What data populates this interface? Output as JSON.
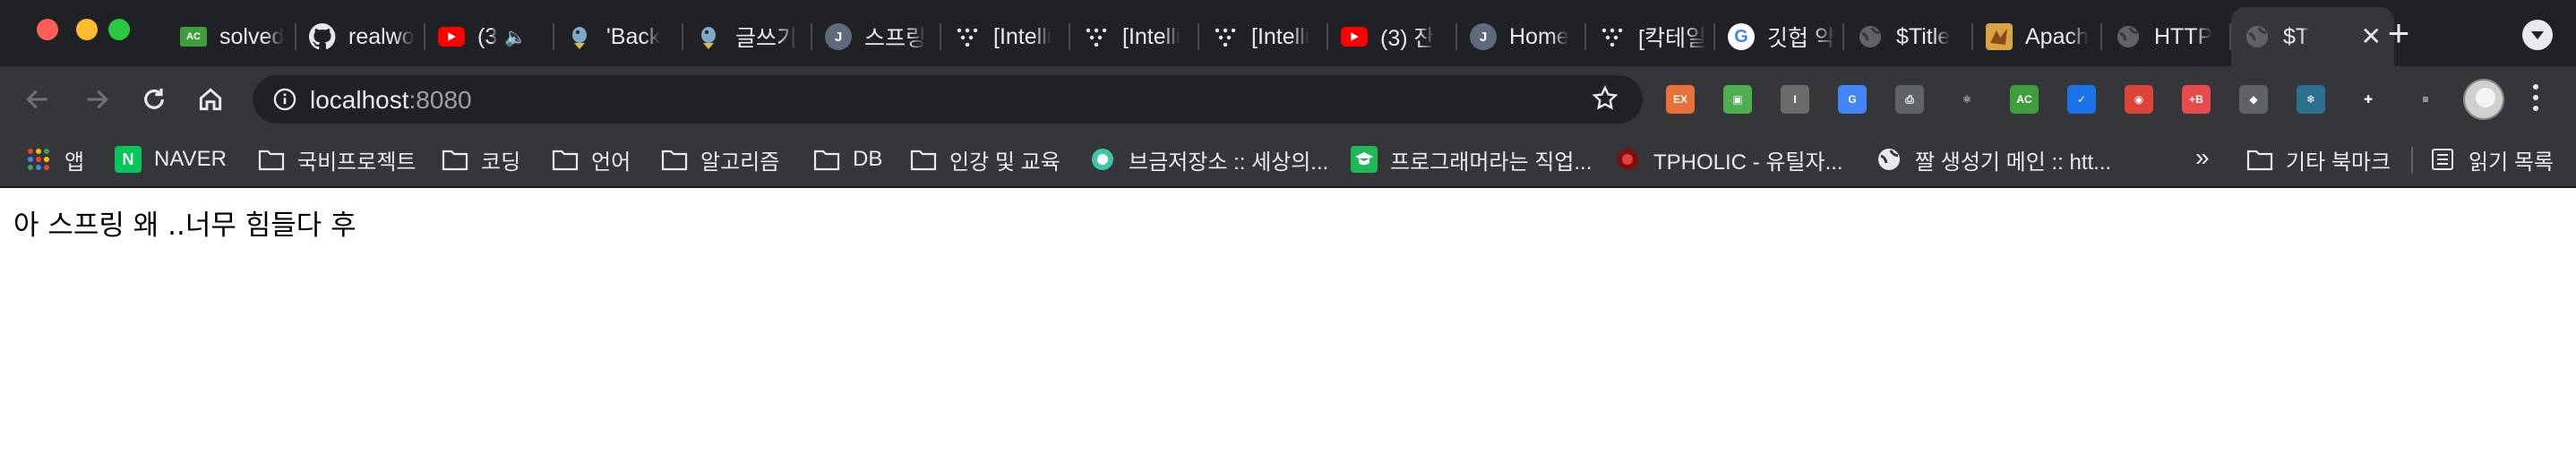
{
  "tabs": [
    {
      "title": "solved",
      "favicon": "ac-icon"
    },
    {
      "title": "realwo",
      "favicon": "github-icon"
    },
    {
      "title": "(3",
      "favicon": "youtube-icon",
      "audio": true
    },
    {
      "title": "'Back",
      "favicon": "bird-icon"
    },
    {
      "title": "글쓰기",
      "favicon": "bird-icon"
    },
    {
      "title": "스프링",
      "favicon": "j-icon"
    },
    {
      "title": "[Intelli",
      "favicon": "dots-icon"
    },
    {
      "title": "[Intelli",
      "favicon": "dots-icon"
    },
    {
      "title": "[Intelli",
      "favicon": "dots-icon"
    },
    {
      "title": "(3) 잔",
      "favicon": "youtube-icon"
    },
    {
      "title": "Home",
      "favicon": "j-icon"
    },
    {
      "title": "[칵테일",
      "favicon": "dots-icon"
    },
    {
      "title": "깃헙 약",
      "favicon": "google-icon"
    },
    {
      "title": "$Title",
      "favicon": "globe-icon"
    },
    {
      "title": "Apach",
      "favicon": "apache-icon"
    },
    {
      "title": "HTTP",
      "favicon": "globe-icon"
    },
    {
      "title": "$T",
      "favicon": "globe-icon",
      "active": true
    }
  ],
  "toolbar": {
    "url_host": "localhost",
    "url_port": ":8080"
  },
  "extensions": [
    {
      "name": "ex-extension-icon",
      "label": "EX",
      "color": "#e8703a"
    },
    {
      "name": "screen-extension-icon",
      "label": "▣",
      "color": "#4caf50"
    },
    {
      "name": "i-extension-icon",
      "label": "I",
      "color": "#6b6b6b"
    },
    {
      "name": "translate-extension-icon",
      "label": "G",
      "color": "#4285f4"
    },
    {
      "name": "print-extension-icon",
      "label": "⎙",
      "color": "#5f6368"
    },
    {
      "name": "react-extension-icon",
      "label": "⚛",
      "color": "#35363a"
    },
    {
      "name": "ac-extension-icon",
      "label": "AC",
      "color": "#3e9e3e"
    },
    {
      "name": "check-extension-icon",
      "label": "✓",
      "color": "#1a73e8"
    },
    {
      "name": "chrome-extension-icon",
      "label": "◉",
      "color": "#db4437"
    },
    {
      "name": "b-extension-icon",
      "label": "+B",
      "color": "#e84b4b"
    },
    {
      "name": "cube-extension-icon",
      "label": "◆",
      "color": "#5f6368"
    },
    {
      "name": "snow-extension-icon",
      "label": "❄",
      "color": "#2c6f8f"
    },
    {
      "name": "puzzle-icon",
      "label": "✚",
      "color": "#35363a"
    },
    {
      "name": "media-icon",
      "label": "≡",
      "color": "#35363a"
    }
  ],
  "bookmarks": [
    {
      "label": "앱",
      "icon": "apps-grid-icon"
    },
    {
      "label": "NAVER",
      "icon": "naver-icon"
    },
    {
      "label": "국비프로젝트",
      "icon": "folder-icon"
    },
    {
      "label": "코딩",
      "icon": "folder-icon"
    },
    {
      "label": "언어",
      "icon": "folder-icon"
    },
    {
      "label": "알고리즘",
      "icon": "folder-icon"
    },
    {
      "label": "DB",
      "icon": "folder-icon"
    },
    {
      "label": "인강 및 교육",
      "icon": "folder-icon"
    },
    {
      "label": "브금저장소 :: 세상의...",
      "icon": "circle-icon"
    },
    {
      "label": "프로그래머라는 직업...",
      "icon": "cap-icon"
    },
    {
      "label": "TPHOLIC - 유틸자...",
      "icon": "tpholic-icon"
    },
    {
      "label": "짤 생성기 메인 :: htt...",
      "icon": "globe-icon"
    }
  ],
  "bookmarks_overflow": "»",
  "other_bookmarks": "기타 북마크",
  "reading_list": "읽기 목록",
  "page": {
    "body_text": "아 스프링 왜 ..너무 힘들다 후"
  }
}
